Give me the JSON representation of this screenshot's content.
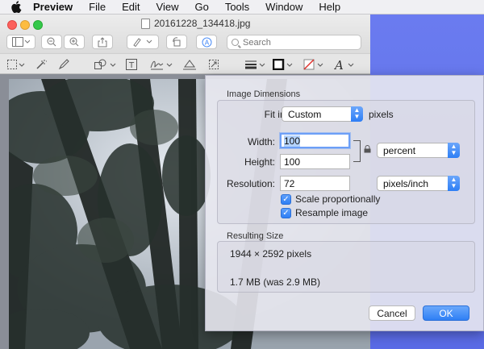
{
  "menubar": {
    "items": [
      "Preview",
      "File",
      "Edit",
      "View",
      "Go",
      "Tools",
      "Window",
      "Help"
    ]
  },
  "window": {
    "title": "20161228_134418.jpg",
    "search_placeholder": "Search"
  },
  "dialog": {
    "image_dimensions_label": "Image Dimensions",
    "fit_into_label": "Fit into:",
    "fit_into_value": "Custom",
    "fit_into_unit": "pixels",
    "width_label": "Width:",
    "width_value": "100",
    "height_label": "Height:",
    "height_value": "100",
    "size_unit": "percent",
    "resolution_label": "Resolution:",
    "resolution_value": "72",
    "resolution_unit": "pixels/inch",
    "scale_proportionally": "Scale proportionally",
    "resample_image": "Resample image",
    "resulting_size_label": "Resulting Size",
    "result_pixels": "1944 × 2592 pixels",
    "result_filesize": "1.7 MB (was 2.9 MB)",
    "cancel_label": "Cancel",
    "ok_label": "OK"
  },
  "colors": {
    "accent": "#2f7ff5",
    "desktop": "#5a6be6"
  }
}
